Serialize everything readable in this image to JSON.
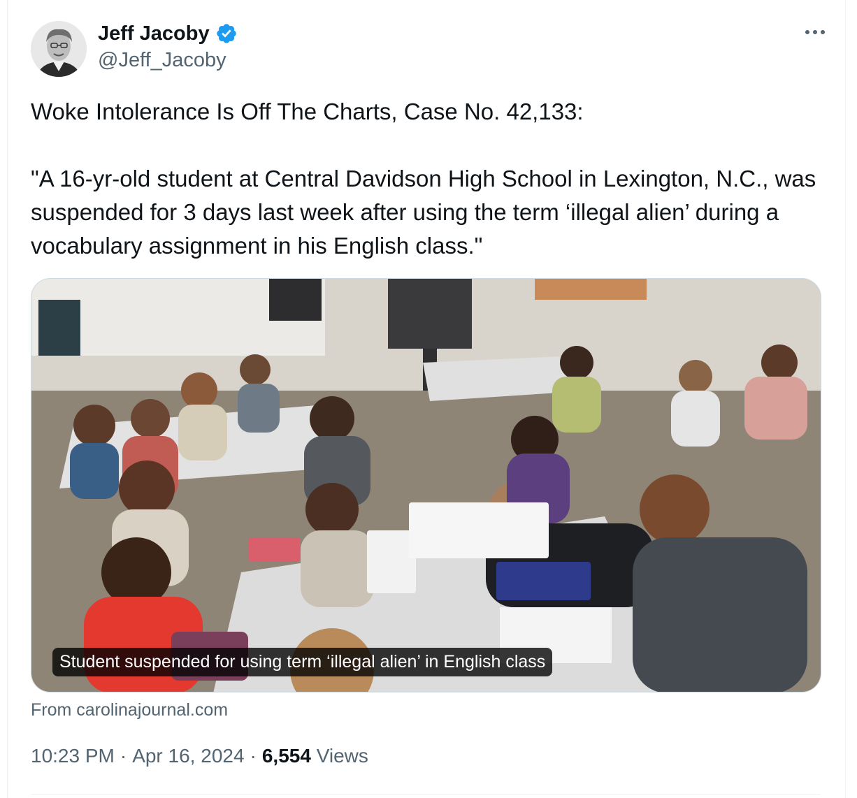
{
  "author": {
    "display_name": "Jeff Jacoby",
    "handle": "@Jeff_Jacoby",
    "verified": true,
    "avatar_icon": "profile-photo",
    "verified_badge_color": "#1d9bf0"
  },
  "tweet": {
    "text": "Woke Intolerance Is Off The Charts, Case No. 42,133:\n\n\"A 16-yr-old student at Central Davidson High School in Lexington, N.C., was suspended for 3 days last week after using the term ‘illegal alien’ during a vocabulary assignment in his English class.\""
  },
  "link_card": {
    "caption": "Student suspended for using term ‘illegal alien’ in English class",
    "source": "From carolinajournal.com"
  },
  "meta": {
    "time": "10:23 PM",
    "date": "Apr 16, 2024",
    "views_count": "6,554",
    "views_label": "Views",
    "separator": "·"
  },
  "colors": {
    "primary_text": "#0f1419",
    "secondary_text": "#536471",
    "border": "#cfd9de"
  }
}
